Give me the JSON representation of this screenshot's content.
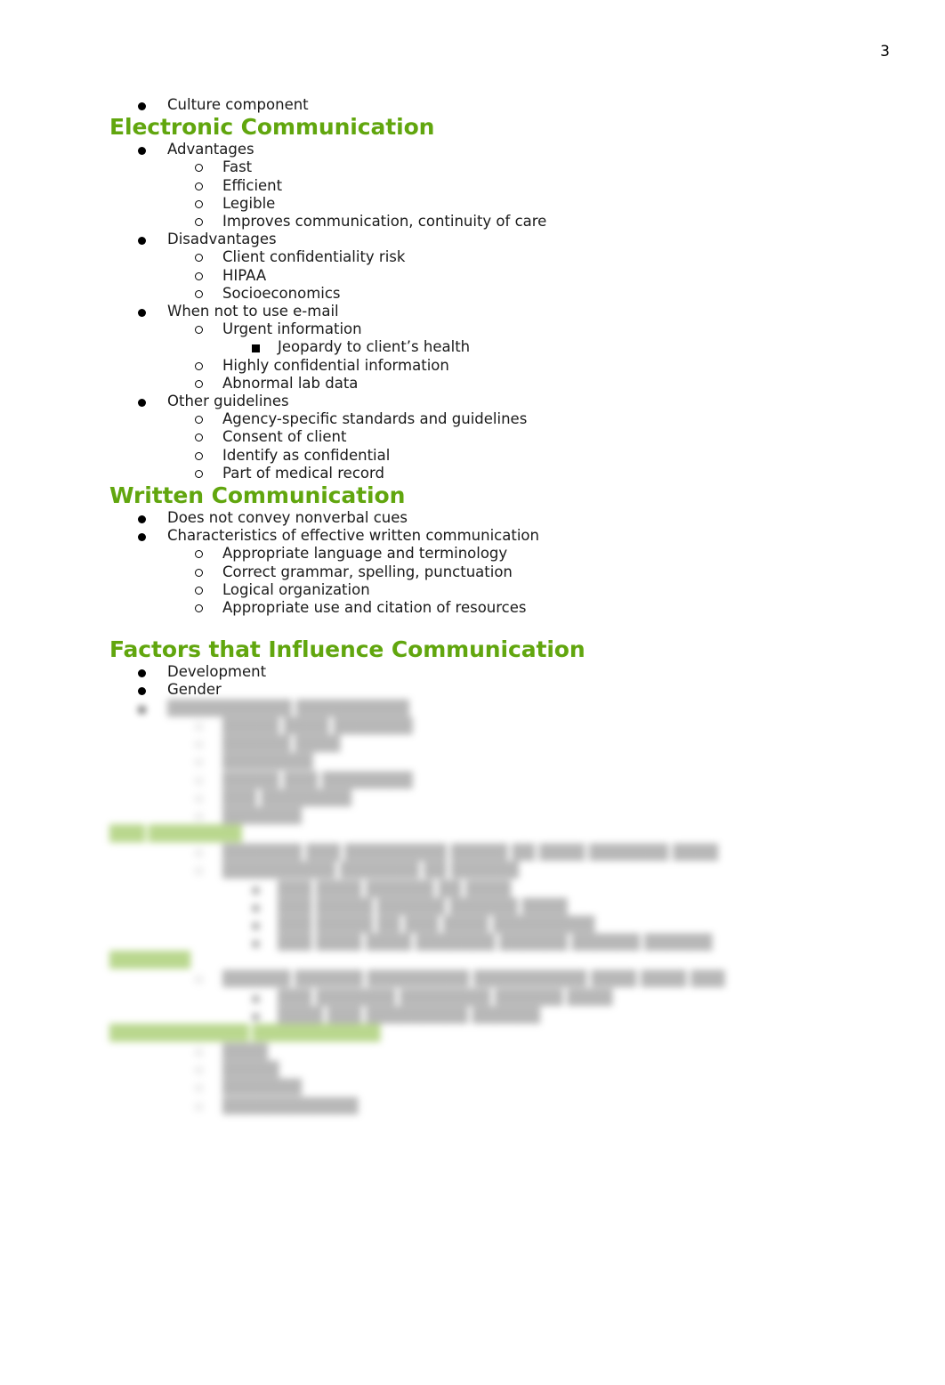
{
  "page": {
    "number": "3"
  },
  "top_item": {
    "label": "Culture component"
  },
  "sections": {
    "electronic": {
      "heading": "Electronic Communication",
      "advantages": {
        "label": "Advantages",
        "items": [
          "Fast",
          "Efficient",
          "Legible",
          "Improves communication, continuity of care"
        ]
      },
      "disadvantages": {
        "label": "Disadvantages",
        "items": [
          "Client confidentiality risk",
          "HIPAA",
          "Socioeconomics"
        ]
      },
      "when_not": {
        "label": "When not to use e-mail",
        "urgent": "Urgent information",
        "urgent_sub": "Jeopardy to client’s health",
        "items": [
          "Highly confidential information",
          "Abnormal lab data"
        ]
      },
      "other": {
        "label": "Other guidelines",
        "items": [
          "Agency-specific standards and guidelines",
          "Consent of client",
          "Identify as confidential",
          "Part of medical record"
        ]
      }
    },
    "written": {
      "heading": "Written Communication",
      "items": [
        "Does not convey nonverbal cues",
        "Characteristics of effective written communication"
      ],
      "characteristics": [
        "Appropriate language and terminology",
        "Correct grammar, spelling, punctuation",
        "Logical organization",
        "Appropriate use and citation of resources"
      ]
    },
    "factors": {
      "heading": "Factors that Influence Communication",
      "items": [
        "Development",
        "Gender"
      ]
    }
  },
  "obscured": {
    "note": "text illegible (blurred)",
    "group_a": {
      "lead": "███████████ ██████████",
      "items": [
        "█████ ████ ███████",
        "██████ ████",
        "████████",
        "█████ ███ ████████",
        "███ ████████",
        "███████"
      ]
    },
    "heading_a": "███ ████████",
    "group_b": {
      "items": [
        "███████ ███ █████████ █████ ██ ████ ███████ ████",
        "██████████ ███████ ██ ██████"
      ],
      "subitems": [
        "███ ████ ██████ ██ ████",
        "███ █████ ██████ ██████ ████",
        "███ █████ ██ ███ ████ █████████",
        "███ ████ ████ ███████ ██████ ██████ ██████"
      ]
    },
    "heading_b": "███████",
    "group_c": {
      "items": [
        "██████ ██████ █████████ ██████████ ████ ████ ███"
      ],
      "subitems": [
        "███ ███████ ████████ ██████ ████",
        "████ ███ █████████ ██████"
      ]
    },
    "heading_c": "████████████ ███████████",
    "group_d": {
      "items": [
        "████",
        "█████",
        "███████",
        "████████████"
      ]
    }
  },
  "colors": {
    "heading_green": "#61a60e",
    "highlight_green": "#dcefc0",
    "text_black": "#1a1a1a"
  }
}
